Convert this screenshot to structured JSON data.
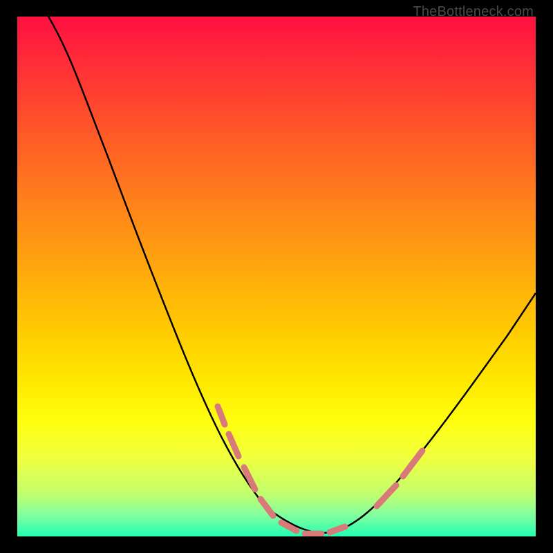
{
  "watermark": "TheBottleneck.com",
  "chart_data": {
    "type": "line",
    "title": "",
    "xlabel": "",
    "ylabel": "",
    "xlim": [
      0,
      100
    ],
    "ylim": [
      0,
      100
    ],
    "series": [
      {
        "name": "main-curve",
        "color": "#000000",
        "x": [
          6,
          12,
          18,
          24,
          30,
          36,
          42,
          46,
          50,
          54,
          58,
          62,
          66,
          70,
          76,
          82,
          88,
          94,
          100
        ],
        "y": [
          100,
          88,
          77,
          66,
          55,
          44,
          33,
          24,
          15,
          8,
          3,
          1,
          2,
          5,
          12,
          21,
          31,
          42,
          54
        ]
      },
      {
        "name": "highlight-dashes",
        "color": "#e08080",
        "style": "dashed",
        "x": [
          40,
          44,
          48,
          52,
          56,
          60,
          64,
          68,
          72,
          76
        ],
        "y": [
          28,
          20,
          12,
          6,
          2,
          1,
          2,
          5,
          9,
          14
        ]
      }
    ],
    "background_gradient": {
      "top": "#ff1040",
      "bottom": "#20ffb0",
      "stops": [
        "red",
        "orange",
        "yellow",
        "green"
      ]
    }
  }
}
